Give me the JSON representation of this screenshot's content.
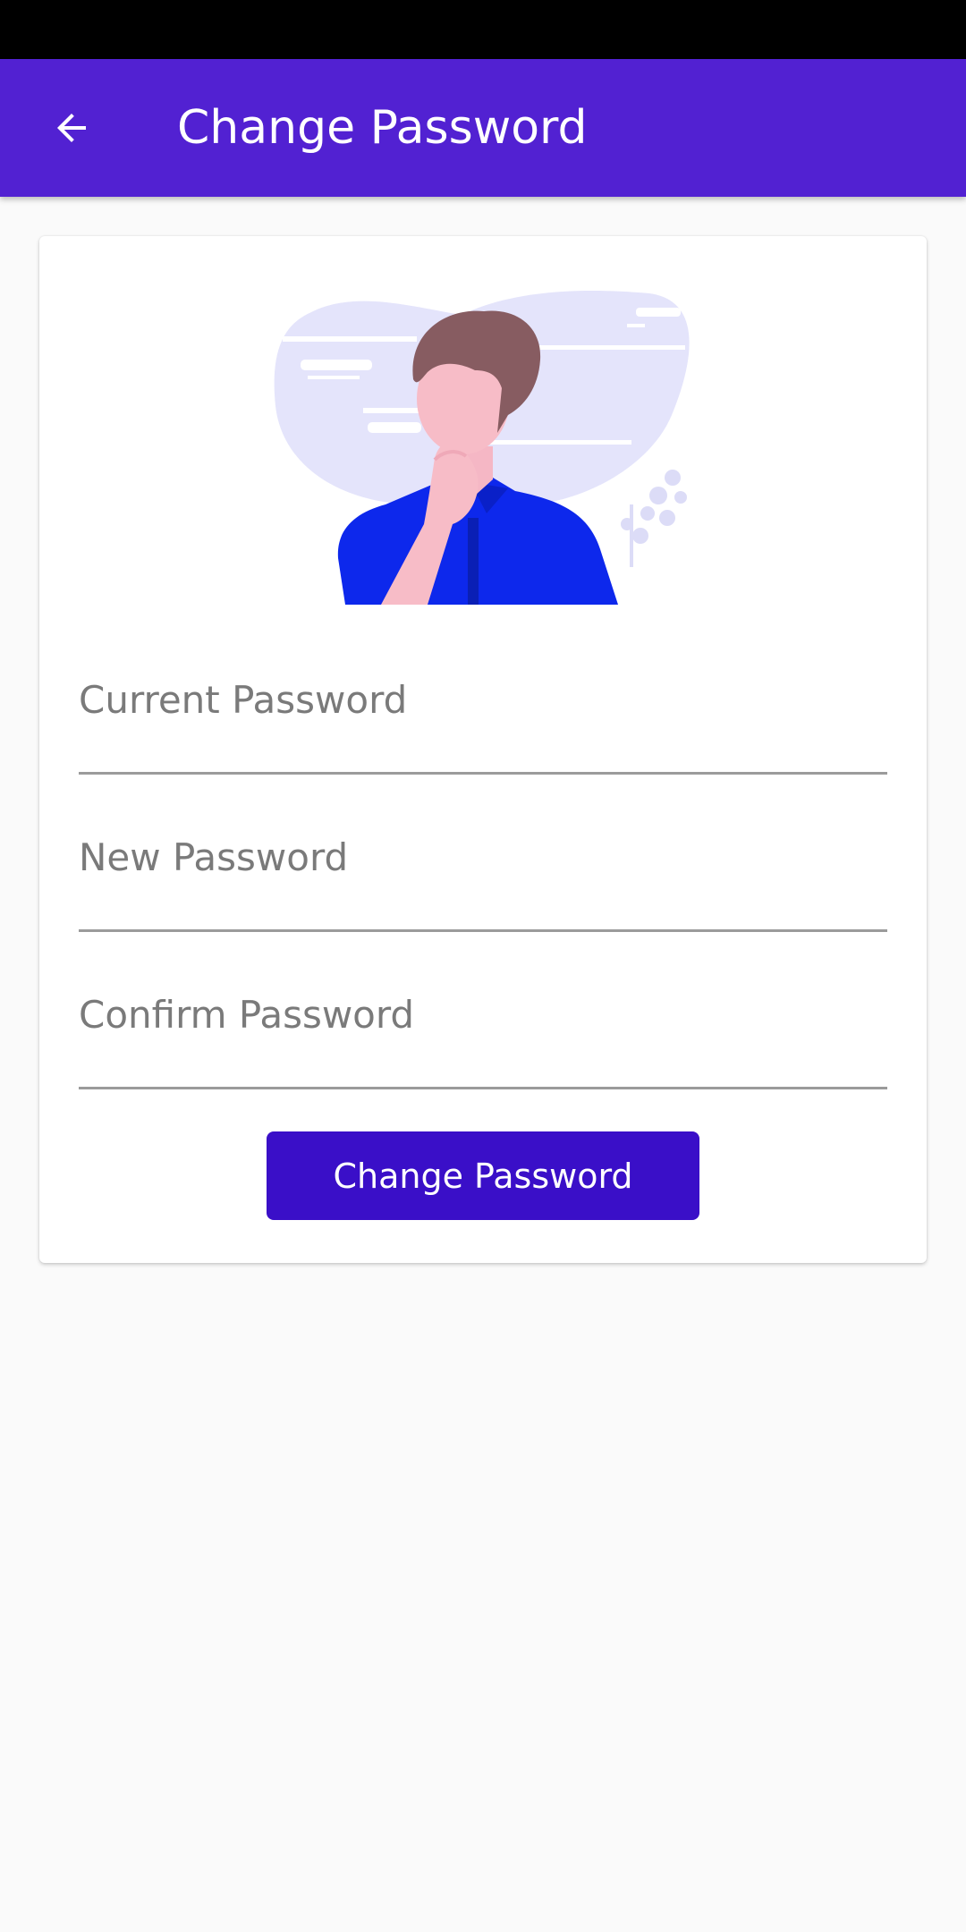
{
  "app_bar": {
    "title": "Change Password",
    "back_icon": "arrow-back-icon"
  },
  "illustration": {
    "icon": "thinking-person-illustration"
  },
  "form": {
    "current_password_placeholder": "Current Password",
    "new_password_placeholder": "New Password",
    "confirm_password_placeholder": "Confirm Password",
    "submit_label": "Change Password"
  },
  "colors": {
    "app_bar": "#5221d2",
    "button": "#3a0fc8",
    "status_bar": "#000000",
    "background": "#fafafa"
  }
}
